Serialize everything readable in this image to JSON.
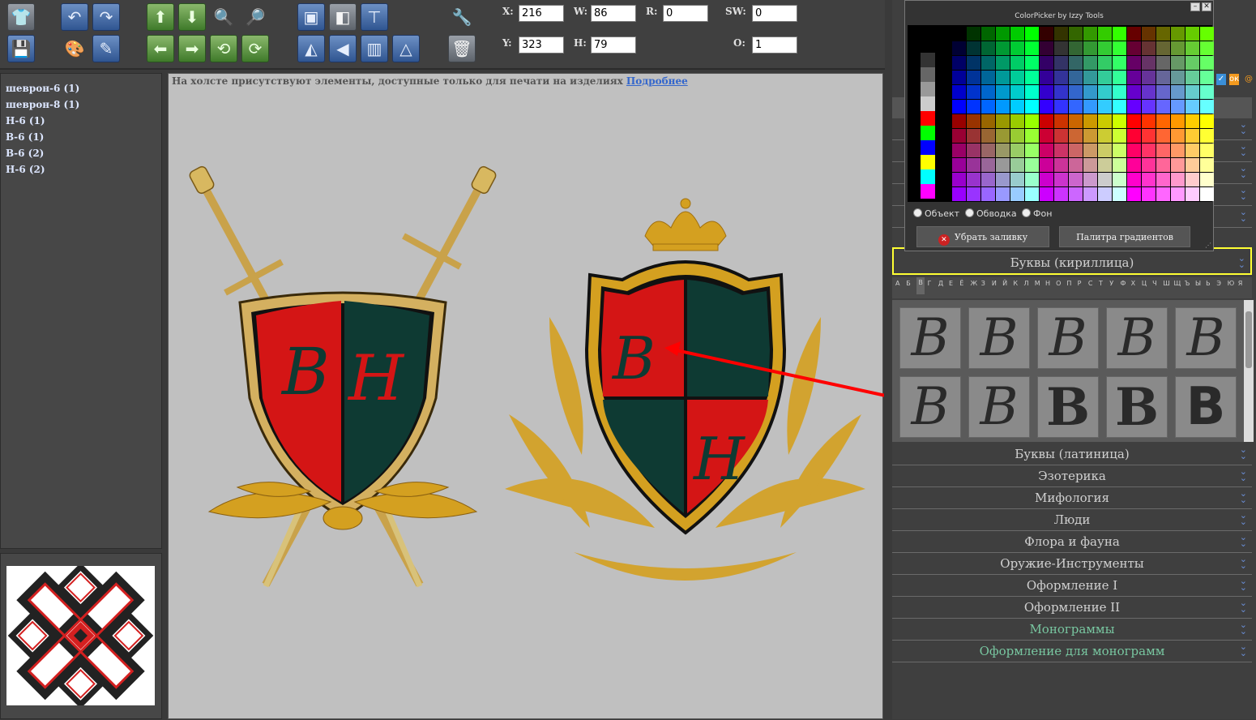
{
  "toolbar": {
    "x_label": "X:",
    "x_value": "216",
    "y_label": "Y:",
    "y_value": "323",
    "w_label": "W:",
    "w_value": "86",
    "h_label": "H:",
    "h_value": "79",
    "r_label": "R:",
    "r_value": "0",
    "sw_label": "SW:",
    "sw_value": "0",
    "o_label": "O:",
    "o_value": "1"
  },
  "layers": [
    "шеврон-6 (1)",
    "шеврон-8 (1)",
    "Н-6 (1)",
    "В-6 (1)",
    "В-6 (2)",
    "Н-6 (2)"
  ],
  "canvas": {
    "notice": "На холсте присутствуют элементы, доступные только для печати на изделиях",
    "notice_link": "Подробнее"
  },
  "colorpicker": {
    "title": "ColorPicker by Izzy Tools",
    "radio_object": "Объект",
    "radio_stroke": "Обводка",
    "radio_background": "Фон",
    "remove_fill": "Убрать заливку",
    "gradient_palette": "Палитра градиентов"
  },
  "accordion": {
    "cyrillic": "Буквы (кириллица)",
    "latin": "Буквы (латиница)",
    "esoterics": "Эзотерика",
    "mythology": "Мифология",
    "people": "Люди",
    "flora_fauna": "Флора и фауна",
    "weapons_tools": "Оружие-Инструменты",
    "decoration1": "Оформление I",
    "decoration2": "Оформление II",
    "monograms": "Монограммы",
    "monogram_decoration": "Оформление для монограмм"
  },
  "alphabet": [
    "А",
    "Б",
    "В",
    "Г",
    "Д",
    "Е",
    "Ё",
    "Ж",
    "З",
    "И",
    "Й",
    "К",
    "Л",
    "М",
    "Н",
    "О",
    "П",
    "Р",
    "С",
    "Т",
    "У",
    "Ф",
    "Х",
    "Ц",
    "Ч",
    "Ш",
    "Щ",
    "Ъ",
    "Ы",
    "Ь",
    "Э",
    "Ю",
    "Я"
  ],
  "glyphs": [
    "B",
    "B",
    "B",
    "B",
    "B",
    "B",
    "B",
    "B",
    "B",
    "B"
  ],
  "colors": {
    "shield_red": "#d41515",
    "shield_green": "#0e3a33",
    "gold": "#d4a020",
    "highlight_yellow": "#ffff33",
    "arrow_red": "#ff0000"
  },
  "icons": [
    "tshirt-icon",
    "undo-icon",
    "redo-icon",
    "move-up-icon",
    "move-down-icon",
    "zoom-in-icon",
    "zoom-out-icon",
    "bring-front-icon",
    "send-back-icon",
    "align-icon",
    "tools-icon",
    "save-icon",
    "palette-icon",
    "draw-icon",
    "move-left-icon",
    "move-right-icon",
    "rotate-left-icon",
    "rotate-right-icon",
    "flip-icon",
    "mirror-icon",
    "distribute-icon",
    "trash-icon"
  ]
}
